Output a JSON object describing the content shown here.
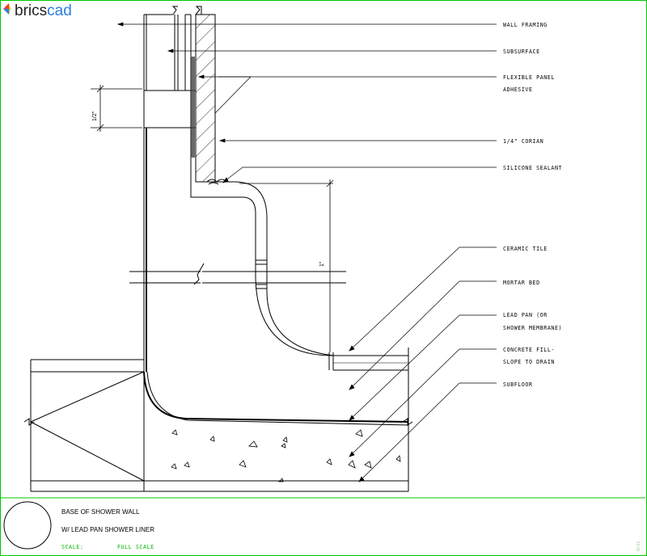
{
  "logo": {
    "prefix": "brics",
    "suffix": "cad"
  },
  "callouts": [
    {
      "id": "wall-framing",
      "lines": [
        "WALL FRAMING"
      ]
    },
    {
      "id": "subsurface",
      "lines": [
        "SUBSURFACE"
      ]
    },
    {
      "id": "flexible-panel-adhesive",
      "lines": [
        "FLEXIBLE PANEL",
        "ADHESIVE"
      ]
    },
    {
      "id": "corian",
      "lines": [
        "1/4\" CORIAN"
      ]
    },
    {
      "id": "silicone-sealant",
      "lines": [
        "SILICONE SEALANT"
      ]
    },
    {
      "id": "ceramic-tile",
      "lines": [
        "CERAMIC TILE"
      ]
    },
    {
      "id": "mortar-bed",
      "lines": [
        "MORTAR BED"
      ]
    },
    {
      "id": "lead-pan",
      "lines": [
        "LEAD PAN (OR",
        "SHOWER MEMBRANE)"
      ]
    },
    {
      "id": "concrete-fill",
      "lines": [
        "CONCRETE FILL-",
        "SLOPE TO DRAIN"
      ]
    },
    {
      "id": "subfloor",
      "lines": [
        "SUBFLOOR"
      ]
    }
  ],
  "dimensions": {
    "left": "1/2\"",
    "right": "1\""
  },
  "title_block": {
    "line1": "BASE OF SHOWER WALL",
    "line2": "W/ LEAD PAN SHOWER LINER",
    "scale_label": "SCALE:",
    "scale_value": "FULL SCALE"
  },
  "side_code": "ID-01",
  "colors": {
    "frame": "#00c800",
    "scale_text": "#00b400",
    "logo_brics": "#222222",
    "logo_cad": "#2a7de1"
  }
}
